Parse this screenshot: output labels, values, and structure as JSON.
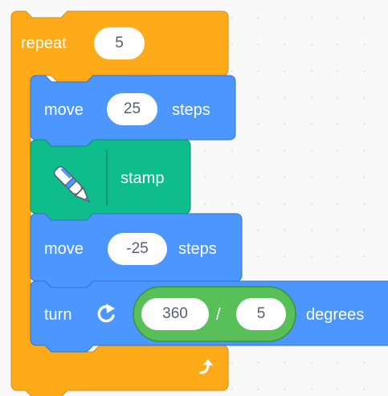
{
  "colors": {
    "control": "#ffab19",
    "control_dark": "#cf8b17",
    "motion": "#4c97ff",
    "motion_dark": "#3373cc",
    "pen": "#0fbd8c",
    "pen_dark": "#0b8e69",
    "operator": "#59c059",
    "operator_dark": "#389438",
    "canvas": "#f9f9f9"
  },
  "repeat": {
    "label": "repeat",
    "times": "5",
    "loop_icon": "loop-arrow-icon"
  },
  "move1": {
    "label": "move",
    "value": "25",
    "unit": "steps"
  },
  "stamp": {
    "label": "stamp",
    "icon": "pen-icon"
  },
  "move2": {
    "label": "move",
    "value": "-25",
    "unit": "steps"
  },
  "turn": {
    "label": "turn",
    "icon": "rotate-clockwise-icon",
    "operator": {
      "left": "360",
      "symbol": "/",
      "right": "5"
    },
    "unit": "degrees"
  }
}
